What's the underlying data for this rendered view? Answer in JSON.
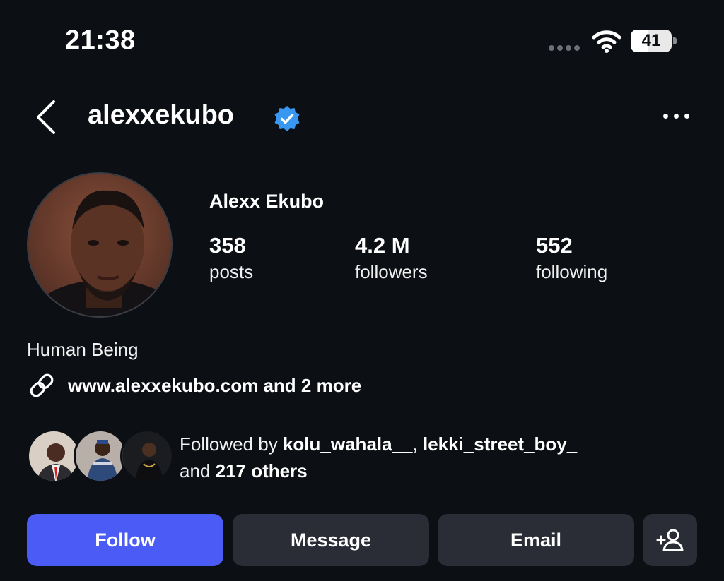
{
  "status_bar": {
    "time": "21:38",
    "battery_level": "41",
    "battery_fraction": 0.41,
    "icons": [
      "signal-dots-icon",
      "wifi-icon",
      "battery-icon"
    ]
  },
  "header": {
    "username": "alexxekubo",
    "verified": true,
    "icons": [
      "back-chevron-icon",
      "verified-badge-icon",
      "more-options-icon"
    ]
  },
  "profile": {
    "display_name": "Alexx Ekubo",
    "stats": [
      {
        "value": "358",
        "label": "posts"
      },
      {
        "value": "4.2 M",
        "label": "followers"
      },
      {
        "value": "552",
        "label": "following"
      }
    ],
    "bio": "Human Being",
    "link": "www.alexxekubo.com and 2 more",
    "link_icon": "link-icon"
  },
  "followed_by": {
    "prefix": "Followed by",
    "user1": "kolu_wahala__",
    "separator": ",",
    "user2": "lekki_street_boy_",
    "conjunction": "and",
    "others": "217 others"
  },
  "actions": {
    "follow": "Follow",
    "message": "Message",
    "email": "Email",
    "add_user_icon": "add-person-icon"
  },
  "colors": {
    "background": "#0c0f14",
    "follow_button": "#4a5cf5",
    "secondary_button": "#2a2d35",
    "verified_blue": "#3897f0"
  }
}
